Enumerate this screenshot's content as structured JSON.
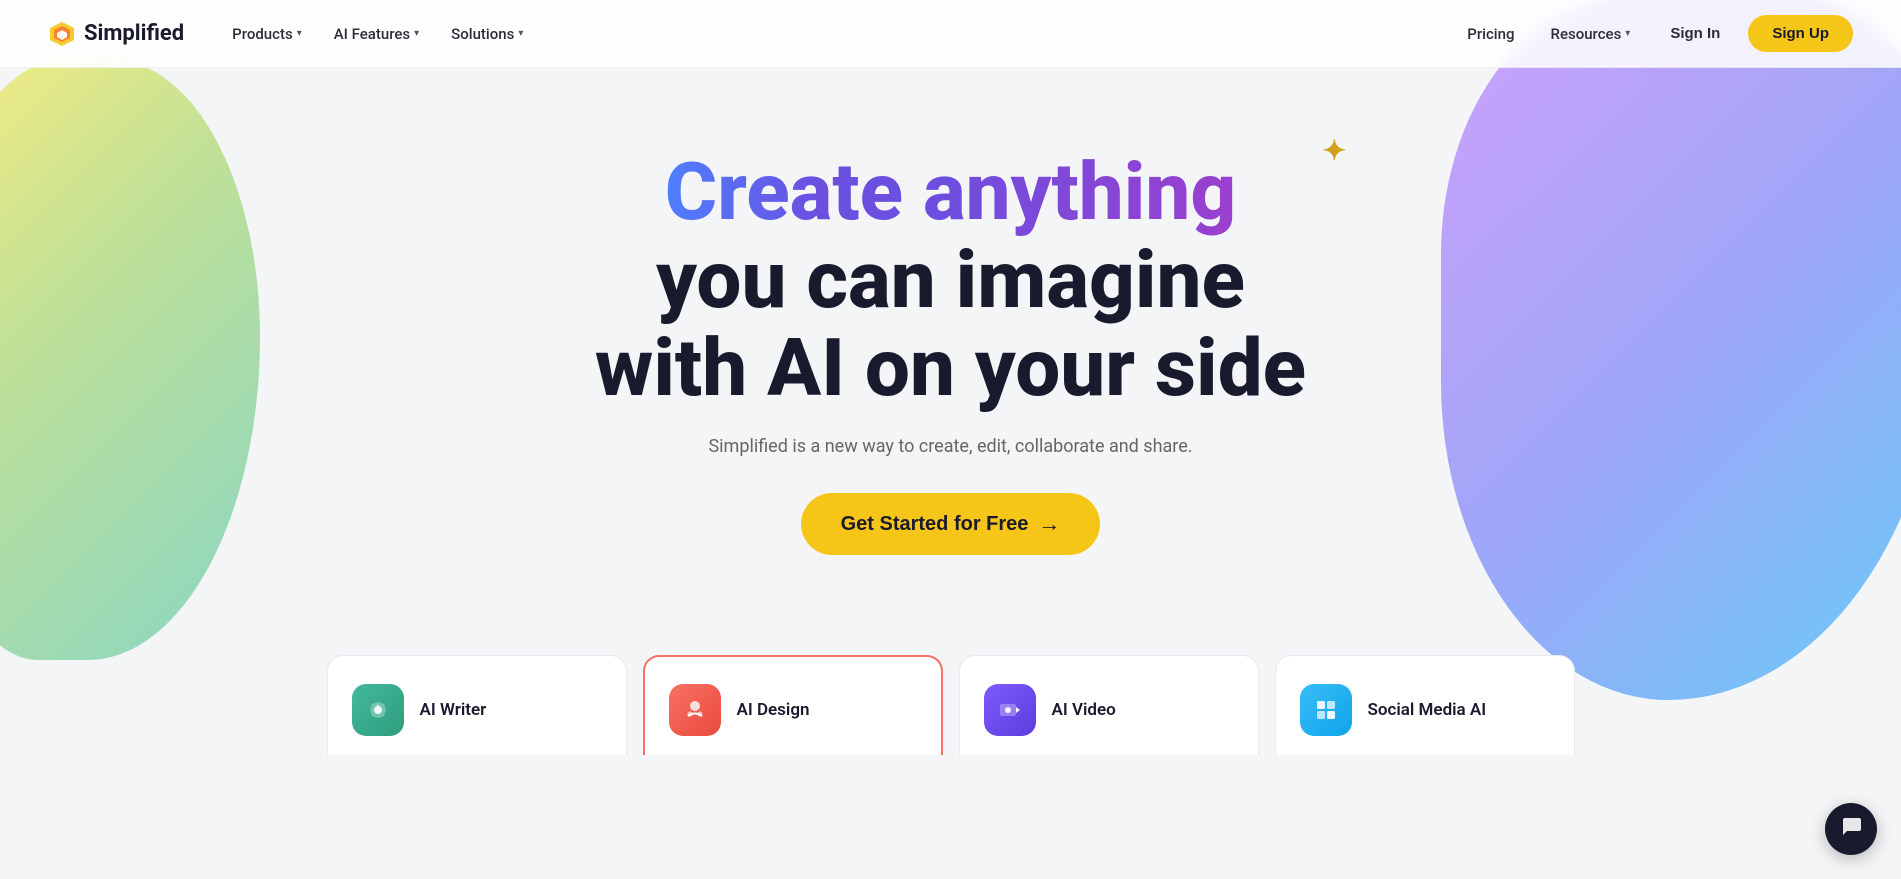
{
  "logo": {
    "text": "Simplified",
    "icon": "⚡"
  },
  "nav": {
    "items": [
      {
        "label": "Products",
        "hasDropdown": true
      },
      {
        "label": "AI Features",
        "hasDropdown": true
      },
      {
        "label": "Solutions",
        "hasDropdown": true
      }
    ],
    "right": [
      {
        "label": "Pricing",
        "hasDropdown": false
      },
      {
        "label": "Resources",
        "hasDropdown": true
      }
    ],
    "signin": "Sign In",
    "signup": "Sign Up"
  },
  "hero": {
    "line1_part1": "Create anything",
    "line2": "you can imagine",
    "line3": "with AI on your side",
    "sparkle": "✦",
    "subtitle": "Simplified is a new way to create, edit, collaborate and share.",
    "cta_label": "Get Started for Free",
    "cta_arrow": "→"
  },
  "features": [
    {
      "id": "ai-writer",
      "label": "AI Writer",
      "icon": "✦",
      "iconStyle": "writer",
      "highlighted": false
    },
    {
      "id": "ai-design",
      "label": "AI Design",
      "icon": "✦",
      "iconStyle": "design",
      "highlighted": true
    },
    {
      "id": "ai-video",
      "label": "AI Video",
      "icon": "▶",
      "iconStyle": "video",
      "highlighted": false
    },
    {
      "id": "social-media",
      "label": "Social Media AI",
      "icon": "▦",
      "iconStyle": "social",
      "highlighted": false
    }
  ],
  "chat": {
    "icon": "💬"
  }
}
